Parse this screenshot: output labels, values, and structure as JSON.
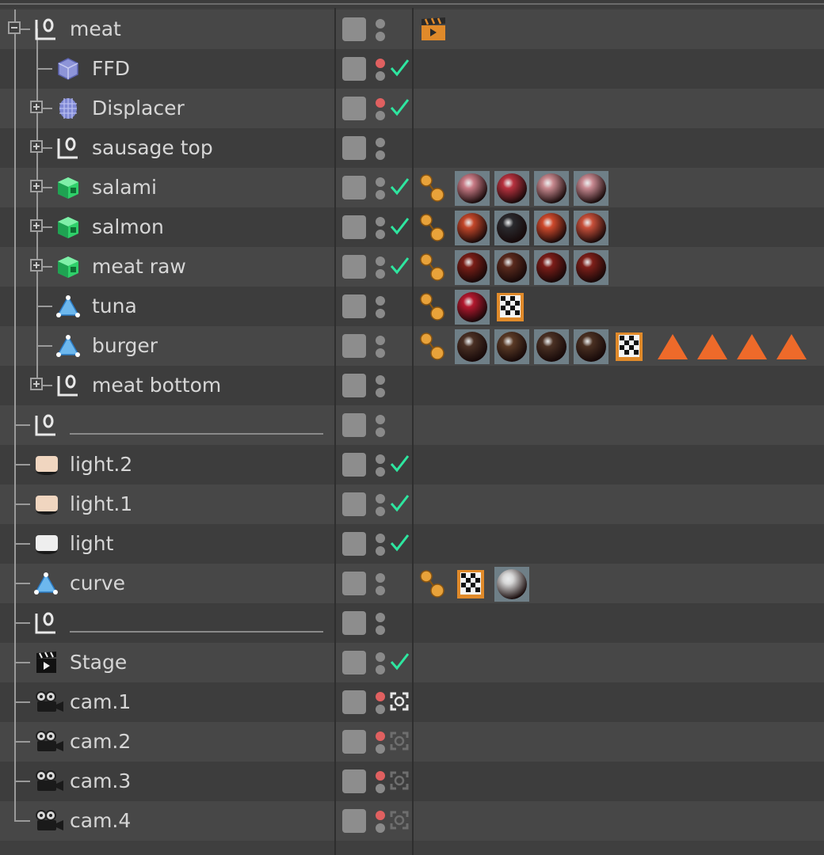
{
  "colors": {
    "row_a": "#474747",
    "row_b": "#3d3d3d",
    "text": "#d6d6d6",
    "check_green": "#2ee6a0",
    "dot_red": "#e06060",
    "dot_gray": "#8a8a8a",
    "vis_box": "#8d8d8d"
  },
  "objects": [
    {
      "label": "meat",
      "icon": "null-object-icon",
      "level": 0,
      "expander": "minus",
      "dot_top": "gray",
      "check": false,
      "tags": [],
      "clap": true
    },
    {
      "label": "FFD",
      "icon": "ffd-deformer-icon",
      "level": 1,
      "expander": "none",
      "dot_top": "red",
      "check": true,
      "tags": []
    },
    {
      "label": "Displacer",
      "icon": "displacer-deformer-icon",
      "level": 1,
      "expander": "plus",
      "dot_top": "red",
      "check": true,
      "tags": []
    },
    {
      "label": "sausage top",
      "icon": "null-object-icon",
      "level": 1,
      "expander": "plus",
      "dot_top": "gray",
      "check": false,
      "tags": []
    },
    {
      "label": "salami",
      "icon": "cube-object-icon",
      "level": 1,
      "expander": "plus",
      "dot_top": "gray",
      "check": true,
      "tags": [
        "phong",
        "mat:#c97b86",
        "mat:#b8323f",
        "mat:#c98a90",
        "mat:#c98a92"
      ]
    },
    {
      "label": "salmon",
      "icon": "cube-object-icon",
      "level": 1,
      "expander": "plus",
      "dot_top": "gray",
      "check": true,
      "tags": [
        "phong",
        "mat:#c3472a",
        "mat:#2a2a2e",
        "mat:#cf4a2c",
        "mat:#c8503a"
      ]
    },
    {
      "label": "meat raw",
      "icon": "cube-object-icon",
      "level": 1,
      "expander": "plus",
      "dot_top": "gray",
      "check": true,
      "tags": [
        "phong",
        "mat:#7a1e17",
        "mat:#5a2a1d",
        "mat:#7c1d18",
        "mat:#7e1f19"
      ]
    },
    {
      "label": "tuna",
      "icon": "polygon-object-icon",
      "level": 1,
      "expander": "none",
      "dot_top": "gray",
      "check": false,
      "tags": [
        "phong",
        "mat:#b3182e",
        "checker"
      ]
    },
    {
      "label": "burger",
      "icon": "polygon-object-icon",
      "level": 1,
      "expander": "none",
      "dot_top": "gray",
      "check": false,
      "tags": [
        "phong",
        "mat:#4a3024",
        "mat:#5a3a26",
        "mat:#4b3124",
        "mat:#4a3022",
        "checker",
        "selection",
        "selection",
        "selection",
        "selection"
      ]
    },
    {
      "label": "meat bottom",
      "icon": "null-object-icon",
      "level": 1,
      "expander": "plus",
      "dot_top": "gray",
      "check": false,
      "tags": []
    },
    {
      "label": "",
      "icon": "null-object-icon",
      "level": 0,
      "expander": "none",
      "dot_top": "gray",
      "check": false,
      "tags": [],
      "underline": true
    },
    {
      "label": "light.2",
      "icon": "light-object-icon",
      "level": 0,
      "expander": "none",
      "dot_top": "gray",
      "check": true,
      "tags": [],
      "light": "#f0d6c0"
    },
    {
      "label": "light.1",
      "icon": "light-object-icon",
      "level": 0,
      "expander": "none",
      "dot_top": "gray",
      "check": true,
      "tags": [],
      "light": "#f0d6c0"
    },
    {
      "label": "light",
      "icon": "light-object-icon",
      "level": 0,
      "expander": "none",
      "dot_top": "gray",
      "check": true,
      "tags": [],
      "light": "#eeeeee"
    },
    {
      "label": "curve",
      "icon": "polygon-object-icon",
      "level": 0,
      "expander": "none",
      "dot_top": "gray",
      "check": false,
      "tags": [
        "phong",
        "checker",
        "mat:#d6d6d6"
      ]
    },
    {
      "label": "",
      "icon": "null-object-icon",
      "level": 0,
      "expander": "none",
      "dot_top": "gray",
      "check": false,
      "tags": [],
      "underline": true
    },
    {
      "label": "Stage",
      "icon": "stage-object-icon",
      "level": 0,
      "expander": "none",
      "dot_top": "gray",
      "check": true,
      "tags": []
    },
    {
      "label": "cam.1",
      "icon": "camera-object-icon",
      "level": 0,
      "expander": "none",
      "dot_top": "red",
      "check": false,
      "tags": [],
      "camtag": "active"
    },
    {
      "label": "cam.2",
      "icon": "camera-object-icon",
      "level": 0,
      "expander": "none",
      "dot_top": "red",
      "check": false,
      "tags": [],
      "camtag": "inactive"
    },
    {
      "label": "cam.3",
      "icon": "camera-object-icon",
      "level": 0,
      "expander": "none",
      "dot_top": "red",
      "check": false,
      "tags": [],
      "camtag": "inactive"
    },
    {
      "label": "cam.4",
      "icon": "camera-object-icon",
      "level": 0,
      "expander": "none",
      "dot_top": "red",
      "check": false,
      "tags": [],
      "camtag": "inactive"
    }
  ]
}
